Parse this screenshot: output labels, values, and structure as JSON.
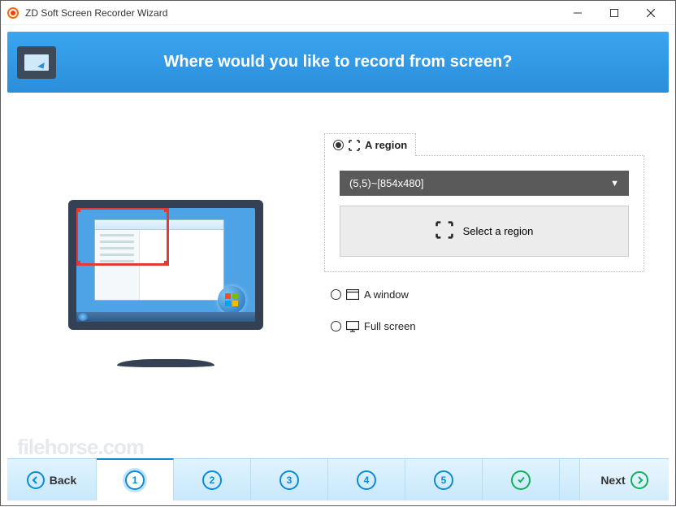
{
  "window": {
    "title": "ZD Soft Screen Recorder Wizard"
  },
  "header": {
    "title": "Where would you like to record from screen?"
  },
  "options": {
    "region": {
      "label": "A region",
      "dropdown_value": "(5,5)~[854x480]",
      "select_button": "Select a region"
    },
    "window_opt": {
      "label": "A window"
    },
    "fullscreen": {
      "label": "Full screen"
    }
  },
  "footer": {
    "back": "Back",
    "next": "Next",
    "steps": [
      "1",
      "2",
      "3",
      "4",
      "5"
    ]
  },
  "watermark": "filehorse.com"
}
